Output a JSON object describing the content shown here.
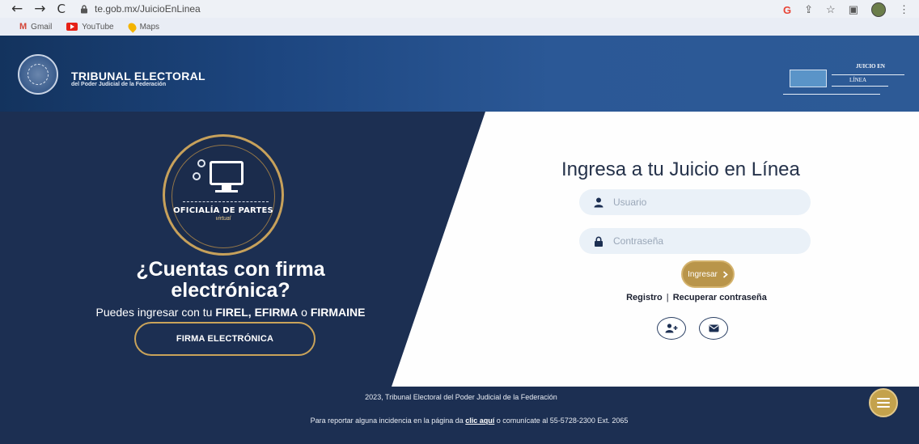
{
  "browser": {
    "url": "te.gob.mx/JuicioEnLinea",
    "bookmarks": [
      {
        "label": "Gmail",
        "icon": "gmail-icon"
      },
      {
        "label": "YouTube",
        "icon": "youtube-icon"
      },
      {
        "label": "Maps",
        "icon": "maps-icon"
      }
    ]
  },
  "header": {
    "title": "TRIBUNAL ELECTORAL",
    "subtitle": "del Poder Judicial de la Federación",
    "logo_right_line1": "JUICIO EN",
    "logo_right_line2": "LÍNEA"
  },
  "badge": {
    "title": "OFICIALÍA DE PARTES",
    "subtitle": "virtual"
  },
  "promo": {
    "question": "¿Cuentas con firma electrónica?",
    "text_prefix": "Puedes ingresar con tu ",
    "highlight": "FIREL, EFIRMA",
    "text_or": " o ",
    "highlight2": "FIRMAINE",
    "button_label": "FIRMA ELECTRÓNICA"
  },
  "login": {
    "title": "Ingresa a tu Juicio en Línea",
    "user_placeholder": "Usuario",
    "password_placeholder": "Contraseña",
    "submit_label": "Ingresar",
    "register_label": "Registro",
    "recover_label": "Recuperar contraseña"
  },
  "footer": {
    "copyright": "2023, Tribunal Electoral del Poder Judicial de la Federación",
    "report_prefix": "Para reportar alguna incidencia en la página da ",
    "report_link": "clic aquí",
    "report_suffix": " o comunícate al 55-5728-2300 Ext. 2065"
  },
  "colors": {
    "navy": "#1c2f52",
    "gold": "#b9954a",
    "header_blue": "#2b5896"
  }
}
